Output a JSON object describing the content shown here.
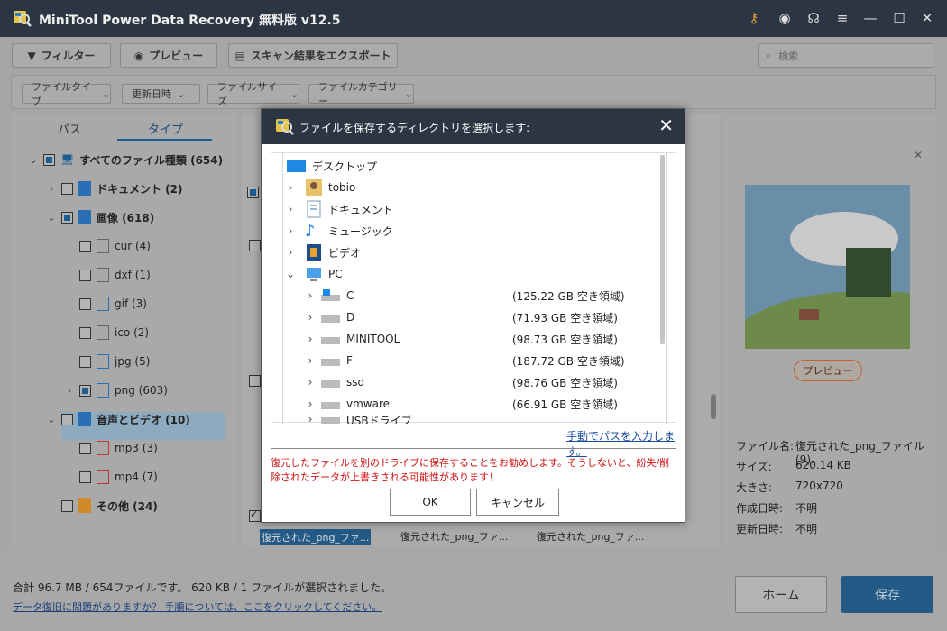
{
  "app": {
    "title": "MiniTool Power Data Recovery 無料版 v12.5"
  },
  "toolbar": {
    "filter_label": "フィルター",
    "preview_label": "プレビュー",
    "export_label": "スキャン結果をエクスポート",
    "search_placeholder": "検索"
  },
  "filters": {
    "file_type": "ファイルタイプ",
    "modified": "更新日時",
    "file_size": "ファイルサイズ",
    "file_category": "ファイルカテゴリー"
  },
  "tabs": {
    "path": "パス",
    "type": "タイプ"
  },
  "tree": {
    "all": "すべてのファイル種類 (654)",
    "documents": "ドキュメント (2)",
    "images": "画像 (618)",
    "cur": "cur (4)",
    "dxf": "dxf (1)",
    "gif": "gif (3)",
    "ico": "ico (2)",
    "jpg": "jpg (5)",
    "png": "png (603)",
    "audio_video": "音声とビデオ (10)",
    "mp3": "mp3 (3)",
    "mp4": "mp4 (7)",
    "other": "その他 (24)"
  },
  "thumbnails": {
    "label_1": "復元された_png_ファ...",
    "label_2": "復元された_png_ファ...",
    "label_3": "復元された_png_ファ..."
  },
  "preview": {
    "button": "プレビュー",
    "name_label": "ファイル名:",
    "name_value": "復元された_png_ファイル(9).",
    "size_label": "サイズ:",
    "size_value": "620.14 KB",
    "dimensions_label": "大きさ:",
    "dimensions_value": "720x720",
    "created_label": "作成日時:",
    "created_value": "不明",
    "modified_label": "更新日時:",
    "modified_value": "不明"
  },
  "status": {
    "summary": "合計 96.7 MB / 654ファイルです。 620 KB / 1 ファイルが選択されました。",
    "help_link": "データ復旧に問題がありますか？ 手順については、ここをクリックしてください。"
  },
  "buttons": {
    "home": "ホーム",
    "save": "保存"
  },
  "dialog": {
    "title": "ファイルを保存するディレクトリを選択します:",
    "items": {
      "desktop": "デスクトップ",
      "tobio": "tobio",
      "documents": "ドキュメント",
      "music": "ミュージック",
      "video": "ビデオ",
      "pc": "PC",
      "drive_c": "C",
      "drive_c_free": "(125.22 GB 空き領域)",
      "drive_d": "D",
      "drive_d_free": "(71.93 GB 空き領域)",
      "drive_minitool": "MINITOOL",
      "drive_minitool_free": "(98.73 GB 空き領域)",
      "drive_f": "F",
      "drive_f_free": "(187.72 GB 空き領域)",
      "drive_ssd": "ssd",
      "drive_ssd_free": "(98.76 GB 空き領域)",
      "drive_vmware": "vmware",
      "drive_vmware_free": "(66.91 GB 空き領域)",
      "usb": "USBドライブ"
    },
    "manual_path": "手動でパスを入力します。",
    "warning": "復元したファイルを別のドライブに保存することをお勧めします。そうしないと、紛失/削除されたデータが上書きされる可能性があります！",
    "ok": "OK",
    "cancel": "キャンセル"
  },
  "colors": {
    "titlebar": "#2c3542",
    "accent": "#245a86",
    "warning": "#d01010",
    "link": "#1a4fa0"
  }
}
